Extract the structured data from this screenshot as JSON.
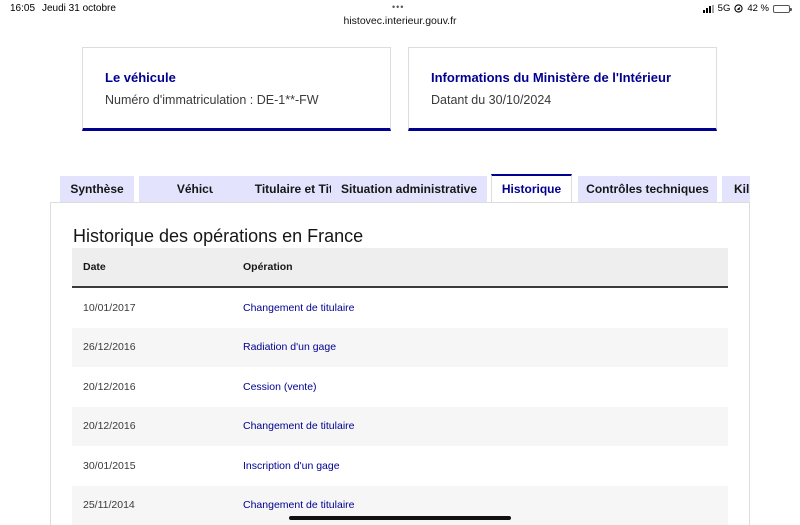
{
  "statusbar": {
    "time": "16:05",
    "date": "Jeudi 31 octobre",
    "url": "histovec.interieur.gouv.fr",
    "network": "5G",
    "battery": "42 %",
    "battery_level": 0.42
  },
  "cards": [
    {
      "title": "Le véhicule",
      "text": "Numéro d'immatriculation : DE-1**-FW"
    },
    {
      "title": "Informations du Ministère de l'Intérieur",
      "text": "Datant du 30/10/2024"
    }
  ],
  "tabs": [
    {
      "label": "Synthèse"
    },
    {
      "label": "Véhicule"
    },
    {
      "label": "Titulaire et Titre"
    },
    {
      "label": "Situation administrative"
    },
    {
      "label": "Historique",
      "active": true
    },
    {
      "label": "Contrôles techniques"
    },
    {
      "label": "Kil"
    }
  ],
  "section": {
    "title": "Historique des opérations en France"
  },
  "table": {
    "headers": {
      "date": "Date",
      "operation": "Opération"
    },
    "rows": [
      {
        "date": "10/01/2017",
        "operation": "Changement de titulaire"
      },
      {
        "date": "26/12/2016",
        "operation": "Radiation d'un gage"
      },
      {
        "date": "20/12/2016",
        "operation": "Cession (vente)"
      },
      {
        "date": "20/12/2016",
        "operation": "Changement de titulaire"
      },
      {
        "date": "30/01/2015",
        "operation": "Inscription d'un gage"
      },
      {
        "date": "25/11/2014",
        "operation": "Changement de titulaire"
      }
    ]
  },
  "colors": {
    "accent": "#000091",
    "tab_bg": "#e3e3fd",
    "header_bg": "#eeeeee",
    "stripe_bg": "#f6f6f6"
  }
}
